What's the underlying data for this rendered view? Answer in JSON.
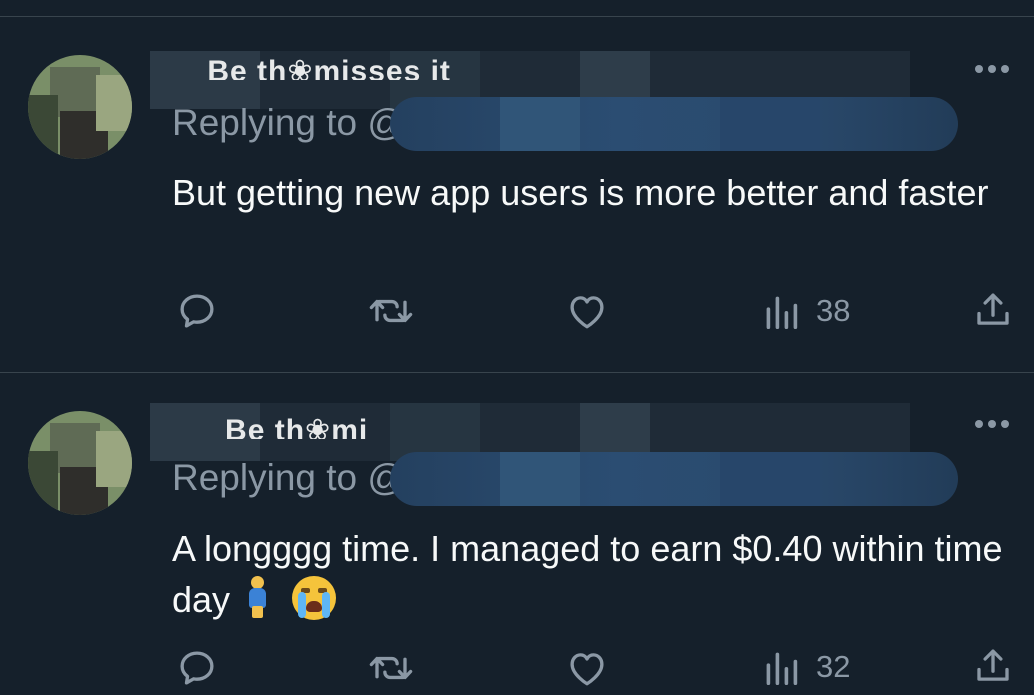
{
  "tweets": [
    {
      "name_fragment": "__Be th❀misses it",
      "replying_prefix": "Replying to @",
      "text": "But getting new app users is more better and faster",
      "actions": {
        "views": "38"
      },
      "icons": [
        "reply-icon",
        "retweet-icon",
        "like-icon",
        "views-icon",
        "share-icon",
        "more-icon"
      ]
    },
    {
      "name_fragment": "___Be th❀mi",
      "replying_prefix": "Replying to @",
      "text": "A longggg time. I managed to earn $0.40 within time day",
      "emoji": [
        "person-standing-emoji",
        "loudly-crying-face-emoji"
      ],
      "actions": {
        "views": "32"
      },
      "icons": [
        "reply-icon",
        "retweet-icon",
        "like-icon",
        "views-icon",
        "share-icon",
        "more-icon"
      ]
    }
  ],
  "colors": {
    "background": "#15202b",
    "text": "#f7f9f9",
    "secondary": "#8b98a5",
    "divider": "#38444d",
    "handle_blur": "#2b4d72"
  }
}
